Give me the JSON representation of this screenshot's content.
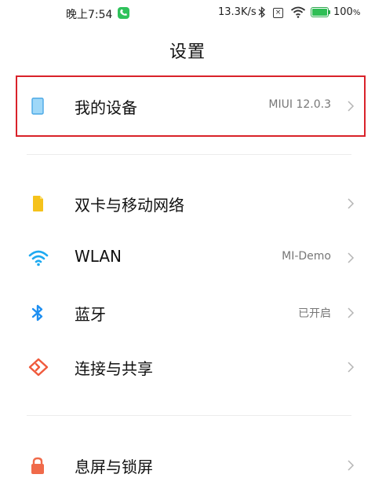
{
  "status_bar": {
    "time": "晚上7:54",
    "net_speed": "13.3K/s",
    "battery_pct": "100"
  },
  "page": {
    "title": "设置"
  },
  "rows": [
    {
      "label": "我的设备",
      "value": "MIUI 12.0.3",
      "icon": "phone-icon"
    },
    {
      "label": "双卡与移动网络",
      "value": "",
      "icon": "sim-card-icon"
    },
    {
      "label": "WLAN",
      "value": "MI-Demo",
      "icon": "wifi-icon"
    },
    {
      "label": "蓝牙",
      "value": "已开启",
      "icon": "bluetooth-icon"
    },
    {
      "label": "连接与共享",
      "value": "",
      "icon": "share-icon"
    },
    {
      "label": "息屏与锁屏",
      "value": "",
      "icon": "lock-icon"
    }
  ],
  "colors": {
    "highlight": "#d9222a",
    "sim": "#f5c21b",
    "wifi": "#1eaaf1",
    "bluetooth": "#1e8ff1",
    "share": "#f05a3c",
    "lock": "#f06a4a"
  }
}
